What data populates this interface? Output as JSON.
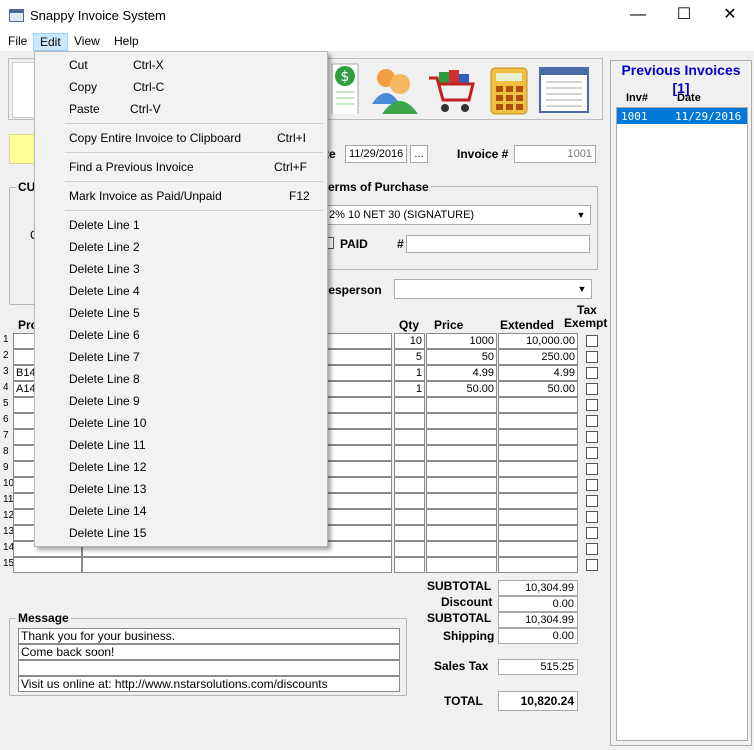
{
  "window": {
    "title": "Snappy Invoice System",
    "minimize": "—",
    "maximize": "☐",
    "close": "✕"
  },
  "menu": {
    "file": "File",
    "edit": "Edit",
    "view": "View",
    "help": "Help"
  },
  "edit_menu": [
    {
      "label": "Cut",
      "shortcut": "Ctrl-X"
    },
    {
      "label": "Copy",
      "shortcut": "Ctrl-C"
    },
    {
      "label": "Paste",
      "shortcut": "Ctrl-V"
    },
    {
      "label": "Copy Entire Invoice to Clipboard",
      "shortcut": "Ctrl+I"
    },
    {
      "label": "Find a Previous Invoice",
      "shortcut": "Ctrl+F"
    },
    {
      "label": "Mark Invoice as Paid/Unpaid",
      "shortcut": "F12"
    },
    {
      "label": "Delete Line 1"
    },
    {
      "label": "Delete Line 2"
    },
    {
      "label": "Delete Line 3"
    },
    {
      "label": "Delete Line 4"
    },
    {
      "label": "Delete Line 5"
    },
    {
      "label": "Delete Line 6"
    },
    {
      "label": "Delete Line 7"
    },
    {
      "label": "Delete Line 8"
    },
    {
      "label": "Delete Line 9"
    },
    {
      "label": "Delete Line 10"
    },
    {
      "label": "Delete Line 11"
    },
    {
      "label": "Delete Line 12"
    },
    {
      "label": "Delete Line 13"
    },
    {
      "label": "Delete Line 14"
    },
    {
      "label": "Delete Line 15"
    }
  ],
  "header": {
    "date_label": "te",
    "date_value": "11/29/2016",
    "date_button": "...",
    "invoice_label": "Invoice #",
    "invoice_value": "1001",
    "customer_label": "CU",
    "customer_letter": "C"
  },
  "terms": {
    "label": "erms of Purchase",
    "value": "2% 10 NET 30 (SIGNATURE)",
    "paid_label": "PAID",
    "hash_label": "#",
    "hash_value": ""
  },
  "salesperson": {
    "label": "lesperson",
    "value": ""
  },
  "table": {
    "headers": {
      "product": "Pro",
      "qty": "Qty",
      "price": "Price",
      "extended": "Extended",
      "tax": "Tax",
      "exempt": "Exempt"
    },
    "rows": [
      {
        "n": "1",
        "product": "",
        "qty": "10",
        "price": "1000",
        "extended": "10,000.00"
      },
      {
        "n": "2",
        "product": "",
        "qty": "5",
        "price": "50",
        "extended": "250.00"
      },
      {
        "n": "3",
        "product": "B14",
        "qty": "1",
        "price": "4.99",
        "extended": "4.99"
      },
      {
        "n": "4",
        "product": "A14",
        "qty": "1",
        "price": "50.00",
        "extended": "50.00"
      },
      {
        "n": "5",
        "product": "",
        "qty": "",
        "price": "",
        "extended": ""
      },
      {
        "n": "6",
        "product": "",
        "qty": "",
        "price": "",
        "extended": ""
      },
      {
        "n": "7",
        "product": "",
        "qty": "",
        "price": "",
        "extended": ""
      },
      {
        "n": "8",
        "product": "",
        "qty": "",
        "price": "",
        "extended": ""
      },
      {
        "n": "9",
        "product": "",
        "qty": "",
        "price": "",
        "extended": ""
      },
      {
        "n": "10",
        "product": "",
        "qty": "",
        "price": "",
        "extended": ""
      },
      {
        "n": "11",
        "product": "",
        "qty": "",
        "price": "",
        "extended": ""
      },
      {
        "n": "12",
        "product": "",
        "qty": "",
        "price": "",
        "extended": ""
      },
      {
        "n": "13",
        "product": "",
        "qty": "",
        "price": "",
        "extended": ""
      },
      {
        "n": "14",
        "product": "",
        "qty": "",
        "price": "",
        "extended": ""
      },
      {
        "n": "15",
        "product": "",
        "qty": "",
        "price": "",
        "extended": ""
      }
    ]
  },
  "totals": {
    "subtotal1_label": "SUBTOTAL",
    "subtotal1": "10,304.99",
    "discount_label": "Discount",
    "discount": "0.00",
    "subtotal2_label": "SUBTOTAL",
    "subtotal2": "10,304.99",
    "shipping_label": "Shipping",
    "shipping": "0.00",
    "tax_label": "Sales Tax",
    "tax": "515.25",
    "total_label": "TOTAL",
    "total": "10,820.24"
  },
  "message": {
    "label": "Message",
    "lines": [
      "Thank you for your business.",
      "Come back soon!",
      "",
      "Visit us online at: http://www.nstarsolutions.com/discounts"
    ]
  },
  "previous": {
    "title": "Previous Invoices",
    "count": "[1]",
    "col_inv": "Inv#",
    "col_date": "Date",
    "rows": [
      {
        "inv": "1001",
        "date": "11/29/2016"
      }
    ]
  },
  "colors": {
    "accent": "#0000cc",
    "selection": "#0078d7",
    "highlight": "#ffff99"
  }
}
